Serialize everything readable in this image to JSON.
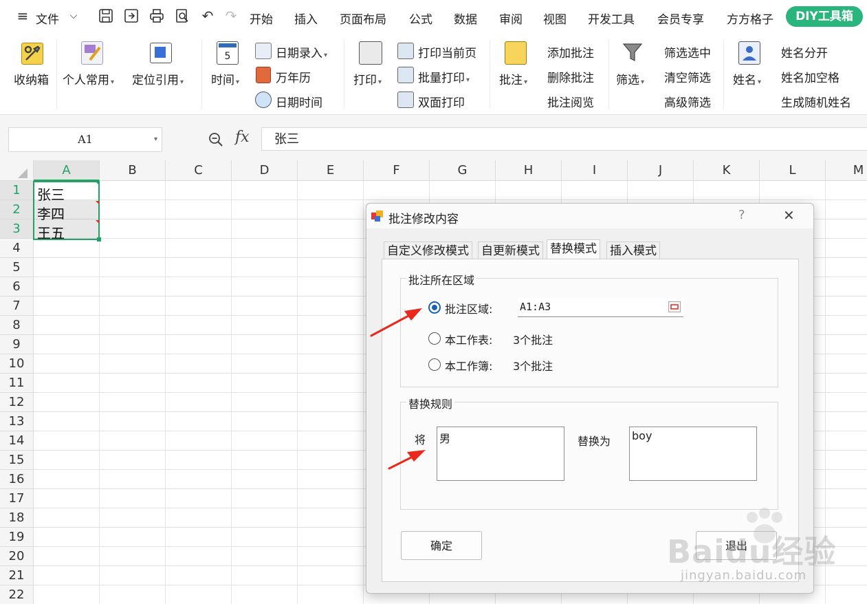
{
  "menu": {
    "file_label": "文件",
    "tabs": [
      "开始",
      "插入",
      "页面布局",
      "公式",
      "数据",
      "审阅",
      "视图",
      "开发工具",
      "会员专享",
      "方方格子"
    ],
    "diy_tab": "DIY工具箱"
  },
  "ribbon": {
    "storage": "收纳箱",
    "personal": "个人常用",
    "locate": "定位引用",
    "time": "时间",
    "date_entry": "日期录入",
    "calendar": "万年历",
    "datetime": "日期时间",
    "print": "打印",
    "print_current": "打印当前页",
    "batch_print": "批量打印",
    "duplex_print": "双面打印",
    "comment": "批注",
    "add_comment": "添加批注",
    "delete_comment": "删除批注",
    "read_comment": "批注阅览",
    "filter": "筛选",
    "filter_selected": "筛选选中",
    "clear_filter": "清空筛选",
    "advanced_filter": "高级筛选",
    "name": "姓名",
    "split_name": "姓名分开",
    "name_add_space": "姓名加空格",
    "random_name": "生成随机姓名"
  },
  "formula_bar": {
    "name_box": "A1",
    "fx_label": "fx",
    "content": "张三"
  },
  "grid": {
    "columns": [
      "A",
      "B",
      "C",
      "D",
      "E",
      "F",
      "G",
      "H",
      "I",
      "J",
      "K",
      "L",
      "M"
    ],
    "rows": [
      "1",
      "2",
      "3",
      "4",
      "5",
      "6",
      "7",
      "8",
      "9",
      "10",
      "11",
      "12",
      "13",
      "14",
      "15",
      "16",
      "17",
      "18",
      "19",
      "20",
      "21",
      "22"
    ],
    "cells": [
      "张三",
      "李四",
      "王五"
    ]
  },
  "dialog": {
    "title": "批注修改内容",
    "help": "?",
    "close": "✕",
    "tabs": [
      "自定义修改模式",
      "自更新模式",
      "替换模式",
      "插入模式"
    ],
    "area_group": "批注所在区域",
    "opt_area": "批注区域:",
    "area_value": "A1:A3",
    "opt_sheet": "本工作表:",
    "sheet_count": "3个批注",
    "opt_book": "本工作簿:",
    "book_count": "3个批注",
    "rule_group": "替换规则",
    "from_label": "将",
    "from_value": "男",
    "to_label": "替换为",
    "to_value": "boy",
    "ok": "确定",
    "exit": "退出"
  },
  "watermark": {
    "brand": "Baidu经验",
    "url": "jingyan.baidu.com"
  },
  "colors": {
    "accent_green": "#2ab57d",
    "selection_green": "#21a366",
    "arrow_red": "#e8291c",
    "radio_blue": "#1a5fb4"
  }
}
